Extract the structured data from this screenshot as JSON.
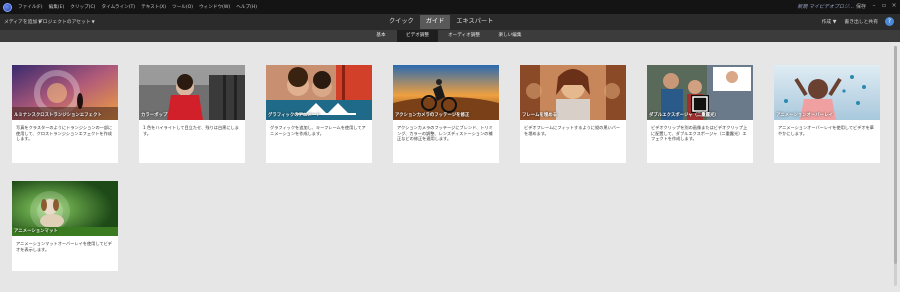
{
  "menubar": {
    "items": [
      "ファイル(F)",
      "編集(E)",
      "クリップ(C)",
      "タイムライン(T)",
      "テキスト(X)",
      "ツール(O)",
      "ウィンドウ(W)",
      "ヘルプ(H)"
    ],
    "project_name": "新規 マイビデオプロジ…",
    "user": "保存"
  },
  "modebar": {
    "add_media": "メディアを追加",
    "project_assets": "プロジェクトのアセット",
    "tabs": [
      "クイック",
      "ガイド",
      "エキスパート"
    ],
    "active_tab": "ガイド",
    "create": "作成",
    "share": "書き出しと共有",
    "help_glyph": "?"
  },
  "categories": {
    "tabs": [
      "基本",
      "ビデオ調整",
      "オーディオ調整",
      "楽しい編集"
    ],
    "active": "ビデオ調整"
  },
  "cards": [
    {
      "title": "ルミナンスクロストランジションエフェクト",
      "desc": "写真をクラスターのようにトランジションの一部に使用して、クロストランジションエフェクトを作成します。"
    },
    {
      "title": "カラーポップ",
      "desc": "1 色をハイライトして目立たせ、残りは白黒にします。"
    },
    {
      "title": "グラフィックのアニメート",
      "desc": "グラフィックを追加し、キーフレームを使用してアニメーションを作成します。"
    },
    {
      "title": "アクションカメラのフッテージを修正",
      "desc": "アクションカメラのフッテージにブレンド、トリミング、カラーの調整、レンズディストーションの補正などの修正を適用します。"
    },
    {
      "title": "フレームを埋める",
      "desc": "ビデオフレームにフィットするように縦の黒いバーを埋めます。"
    },
    {
      "title": "ダブルエクスポージャ（二重露光）",
      "desc": "ビデオクリップを別の画像またはビデオクリップ上に配置して、ダブルエクスポージャ（二重露光）エフェクトを作成します。"
    },
    {
      "title": "アニメーションオーバーレイ",
      "desc": "アニメーションオーバーレイを使用してビデオを華やかにします。"
    },
    {
      "title": "アニメーションマット",
      "desc": "アニメーションマットオーバーレイを使用してビデオを表示します。"
    }
  ]
}
